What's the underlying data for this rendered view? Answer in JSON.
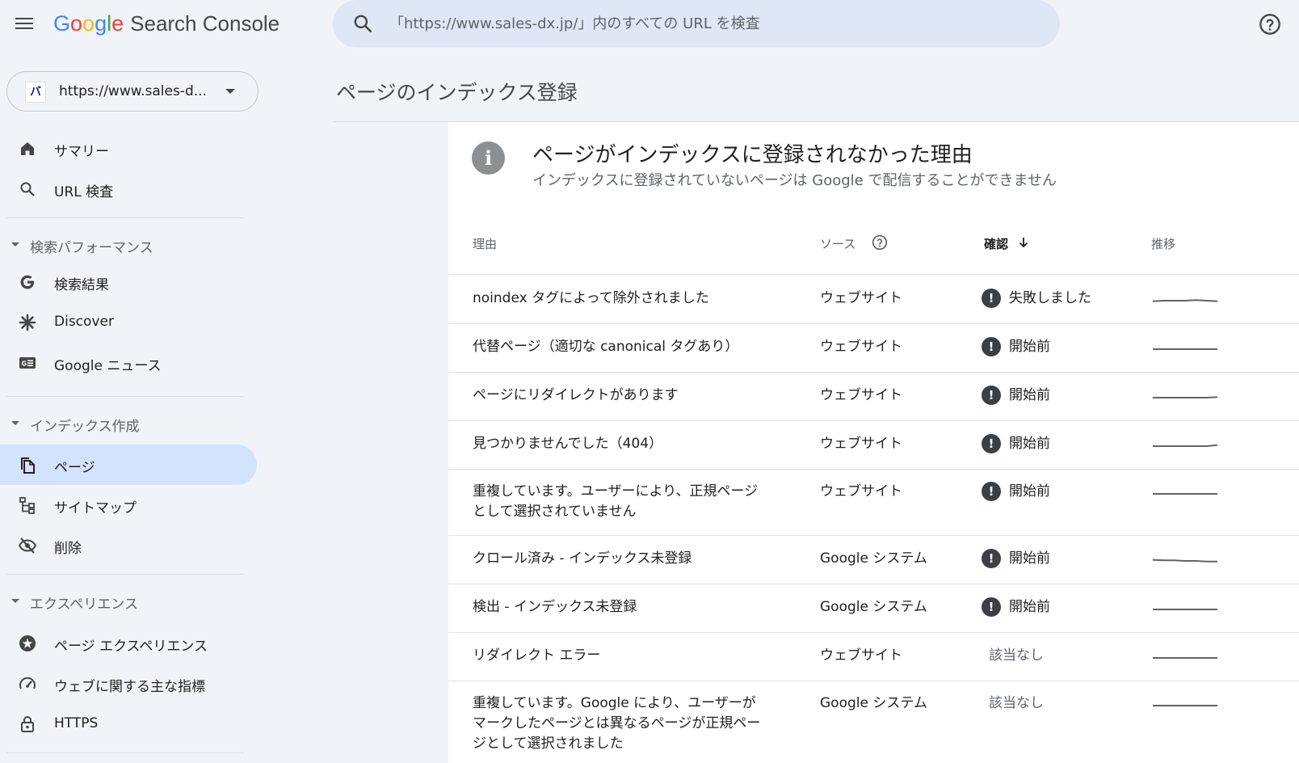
{
  "header": {
    "logo_letters": [
      "G",
      "o",
      "o",
      "g",
      "l",
      "e"
    ],
    "product": "Search Console",
    "search_placeholder": "「https://www.sales-dx.jp/」内のすべての URL を検査"
  },
  "property": {
    "logo_text": "バ",
    "url": "https://www.sales-d..."
  },
  "sidebar": {
    "top_items": [
      {
        "label": "サマリー",
        "icon": "home-icon"
      },
      {
        "label": "URL 検査",
        "icon": "search-icon"
      }
    ],
    "sections": [
      {
        "label": "検索パフォーマンス",
        "items": [
          {
            "label": "検索結果",
            "icon": "google-g-icon"
          },
          {
            "label": "Discover",
            "icon": "asterisk-icon"
          },
          {
            "label": "Google ニュース",
            "icon": "news-icon"
          }
        ]
      },
      {
        "label": "インデックス作成",
        "items": [
          {
            "label": "ページ",
            "icon": "pages-icon",
            "active": true
          },
          {
            "label": "サイトマップ",
            "icon": "sitemap-icon"
          },
          {
            "label": "削除",
            "icon": "visibility-off-icon"
          }
        ]
      },
      {
        "label": "エクスペリエンス",
        "items": [
          {
            "label": "ページ エクスペリエンス",
            "icon": "experience-icon"
          },
          {
            "label": "ウェブに関する主な指標",
            "icon": "speed-icon"
          },
          {
            "label": "HTTPS",
            "icon": "lock-icon"
          }
        ]
      }
    ]
  },
  "main": {
    "page_title": "ページのインデックス登録",
    "card_title": "ページがインデックスに登録されなかった理由",
    "card_subtitle": "インデックスに登録されていないページは Google で配信することができません",
    "info_icon_text": "i",
    "columns": {
      "reason": "理由",
      "source": "ソース",
      "validation": "確認",
      "trend": "推移"
    },
    "status_icon_text": "!",
    "rows": [
      {
        "reason": "noindex タグによって除外されました",
        "source": "ウェブサイト",
        "status": "失敗しました",
        "alert": true,
        "trend": [
          0.45,
          0.5,
          0.5,
          0.5,
          0.55,
          0.5,
          0.45
        ]
      },
      {
        "reason": "代替ページ（適切な canonical タグあり）",
        "source": "ウェブサイト",
        "status": "開始前",
        "alert": true,
        "trend": [
          0.5,
          0.5,
          0.5,
          0.5,
          0.5,
          0.5,
          0.5
        ]
      },
      {
        "reason": "ページにリダイレクトがあります",
        "source": "ウェブサイト",
        "status": "開始前",
        "alert": true,
        "trend": [
          0.5,
          0.5,
          0.5,
          0.5,
          0.5,
          0.5,
          0.55
        ]
      },
      {
        "reason": "見つかりませんでした（404）",
        "source": "ウェブサイト",
        "status": "開始前",
        "alert": true,
        "trend": [
          0.5,
          0.5,
          0.5,
          0.5,
          0.5,
          0.5,
          0.6
        ]
      },
      {
        "reason": "重複しています。ユーザーにより、正規ページとして選択されていません",
        "source": "ウェブサイト",
        "status": "開始前",
        "alert": true,
        "trend": [
          0.5,
          0.5,
          0.5,
          0.5,
          0.5,
          0.5,
          0.5
        ]
      },
      {
        "reason": "クロール済み - インデックス未登録",
        "source": "Google システム",
        "status": "開始前",
        "alert": true,
        "trend": [
          0.6,
          0.55,
          0.55,
          0.5,
          0.5,
          0.45,
          0.45
        ]
      },
      {
        "reason": "検出 - インデックス未登録",
        "source": "Google システム",
        "status": "開始前",
        "alert": true,
        "trend": [
          0.5,
          0.5,
          0.5,
          0.5,
          0.5,
          0.5,
          0.5
        ]
      },
      {
        "reason": "リダイレクト エラー",
        "source": "ウェブサイト",
        "status": "該当なし",
        "alert": false,
        "trend": [
          0.5,
          0.5,
          0.5,
          0.5,
          0.5,
          0.5,
          0.5
        ]
      },
      {
        "reason": "重複しています。Google により、ユーザーがマークしたページとは異なるページが正規ページとして選択されました",
        "source": "Google システム",
        "status": "該当なし",
        "alert": false,
        "trend": [
          0.5,
          0.5,
          0.5,
          0.5,
          0.5,
          0.5,
          0.5
        ]
      }
    ]
  },
  "colors": {
    "background": "#f0f4f9",
    "active_nav": "#d3e3fd",
    "search_bg": "#dfe7f6",
    "alert_icon": "#3c4043"
  }
}
